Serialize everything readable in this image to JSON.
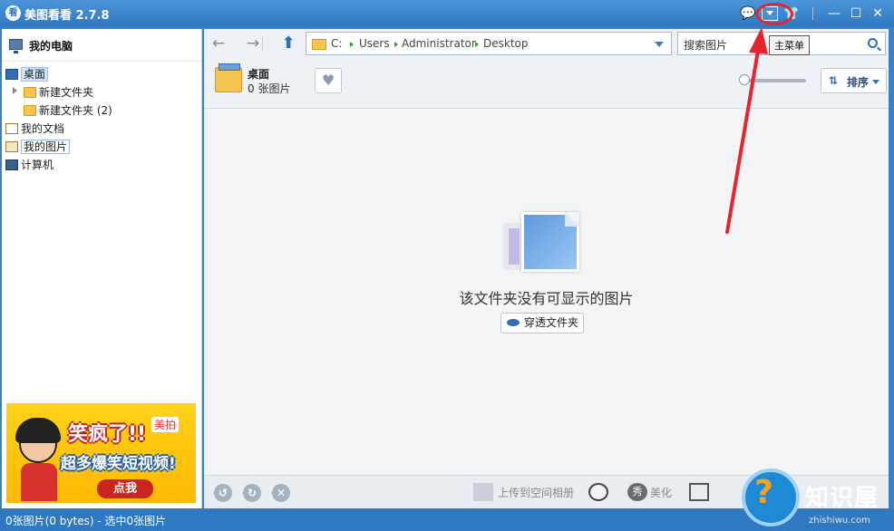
{
  "window": {
    "logo_text": "看",
    "title": "美图看看 2.7.8",
    "buttons": {
      "feedback": "💬",
      "skin": "👕",
      "minimize": "—",
      "maximize": "☐",
      "close": "✕"
    },
    "tooltip": "主菜单"
  },
  "sidebar": {
    "header": "我的电脑",
    "items": [
      {
        "label": "桌面"
      },
      {
        "label": "新建文件夹"
      },
      {
        "label": "新建文件夹 (2)"
      },
      {
        "label": "我的文档"
      },
      {
        "label": "我的图片"
      },
      {
        "label": "计算机"
      }
    ],
    "ad": {
      "headline": "笑疯了!!",
      "brand": "美拍",
      "subline": "超多爆笑短视频!",
      "cta": "点我"
    }
  },
  "toolbar": {
    "back": "←",
    "forward": "→",
    "up": "⬆",
    "path": [
      "C:",
      "Users",
      "Administrator",
      "Desktop"
    ],
    "search_placeholder": "搜索图片"
  },
  "folder": {
    "name": "桌面",
    "count": "0 张图片",
    "fav_icon": "♥",
    "sort_label": "排序"
  },
  "content": {
    "empty_message": "该文件夹没有可显示的图片",
    "peek_button": "穿透文件夹"
  },
  "bottombar": {
    "rotate_left": "↺",
    "rotate_right": "↻",
    "delete": "✕",
    "upload": "上传到空间相册",
    "beautify": "美化",
    "meihua_icon": "秀"
  },
  "status": "0张图片(0 bytes) - 选中0张图片",
  "watermark": {
    "name": "知识屋",
    "url": "zhishiwu.com"
  },
  "colors": {
    "titlebar": "#2f78c2",
    "accent": "#2f6fb5",
    "highlight_red": "#e8232f"
  }
}
